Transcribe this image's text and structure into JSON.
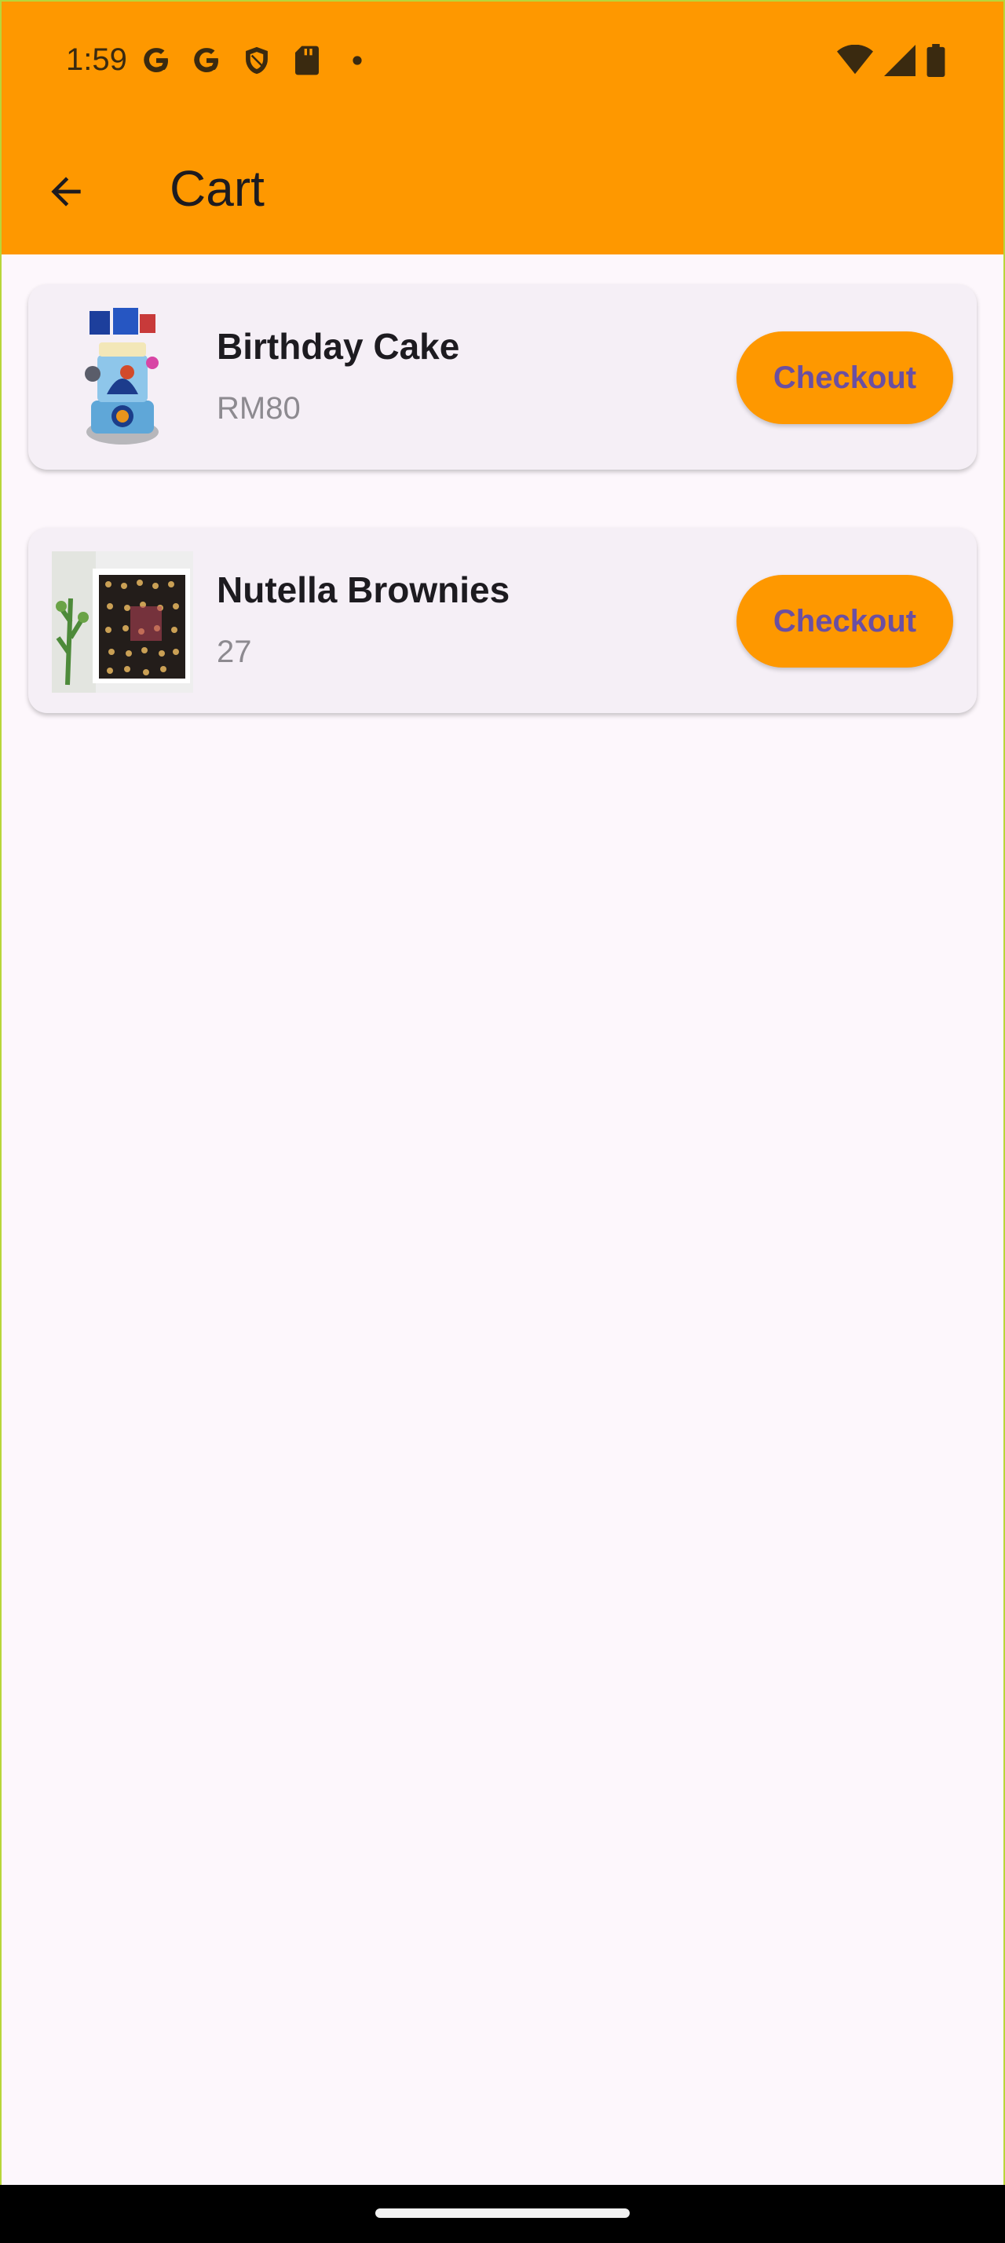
{
  "status_bar": {
    "time": "1:59",
    "left_icons": [
      "google-g-icon",
      "google-g-icon",
      "shield-icon",
      "sd-card-icon",
      "dot-icon"
    ],
    "right_icons": [
      "wifi-icon",
      "signal-icon",
      "battery-icon"
    ]
  },
  "app_bar": {
    "title": "Cart",
    "back_icon": "arrow-back-icon",
    "color": "#fe9800"
  },
  "cart": {
    "items": [
      {
        "name": "Birthday Cake",
        "price": "RM80",
        "button_label": "Checkout",
        "image": "birthday-cake-image"
      },
      {
        "name": "Nutella Brownies",
        "price": "27",
        "button_label": "Checkout",
        "image": "brownies-image"
      }
    ]
  },
  "colors": {
    "accent": "#fe9800",
    "button_text": "#6a4fa2",
    "background": "#fdf7fc",
    "card": "#f5eff6"
  }
}
